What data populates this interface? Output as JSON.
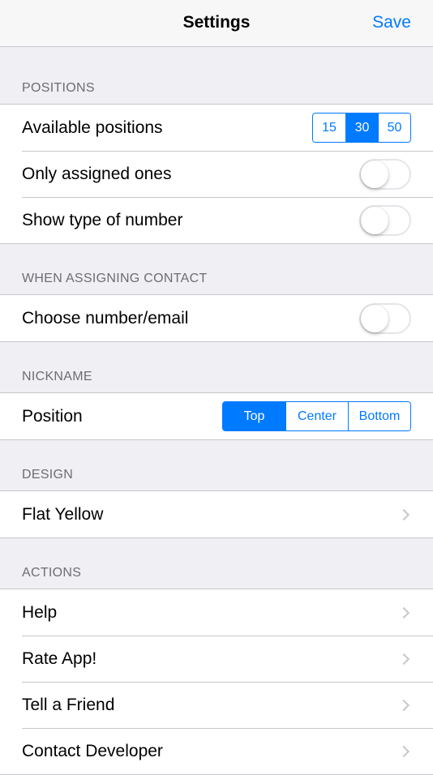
{
  "navbar": {
    "title": "Settings",
    "save_label": "Save"
  },
  "colors": {
    "accent": "#007aff",
    "background": "#efeff4"
  },
  "sections": {
    "positions": {
      "header": "POSITIONS",
      "available_label": "Available positions",
      "available_options": [
        "15",
        "30",
        "50"
      ],
      "available_selected": "30",
      "only_assigned_label": "Only assigned ones",
      "only_assigned_on": false,
      "show_type_label": "Show type of number",
      "show_type_on": false
    },
    "assigning": {
      "header": "WHEN ASSIGNING CONTACT",
      "choose_label": "Choose number/email",
      "choose_on": false
    },
    "nickname": {
      "header": "NICKNAME",
      "position_label": "Position",
      "position_options": [
        "Top",
        "Center",
        "Bottom"
      ],
      "position_selected": "Top"
    },
    "design": {
      "header": "DESIGN",
      "theme_label": "Flat Yellow"
    },
    "actions": {
      "header": "ACTIONS",
      "items": [
        "Help",
        "Rate App!",
        "Tell a Friend",
        "Contact Developer"
      ]
    }
  }
}
